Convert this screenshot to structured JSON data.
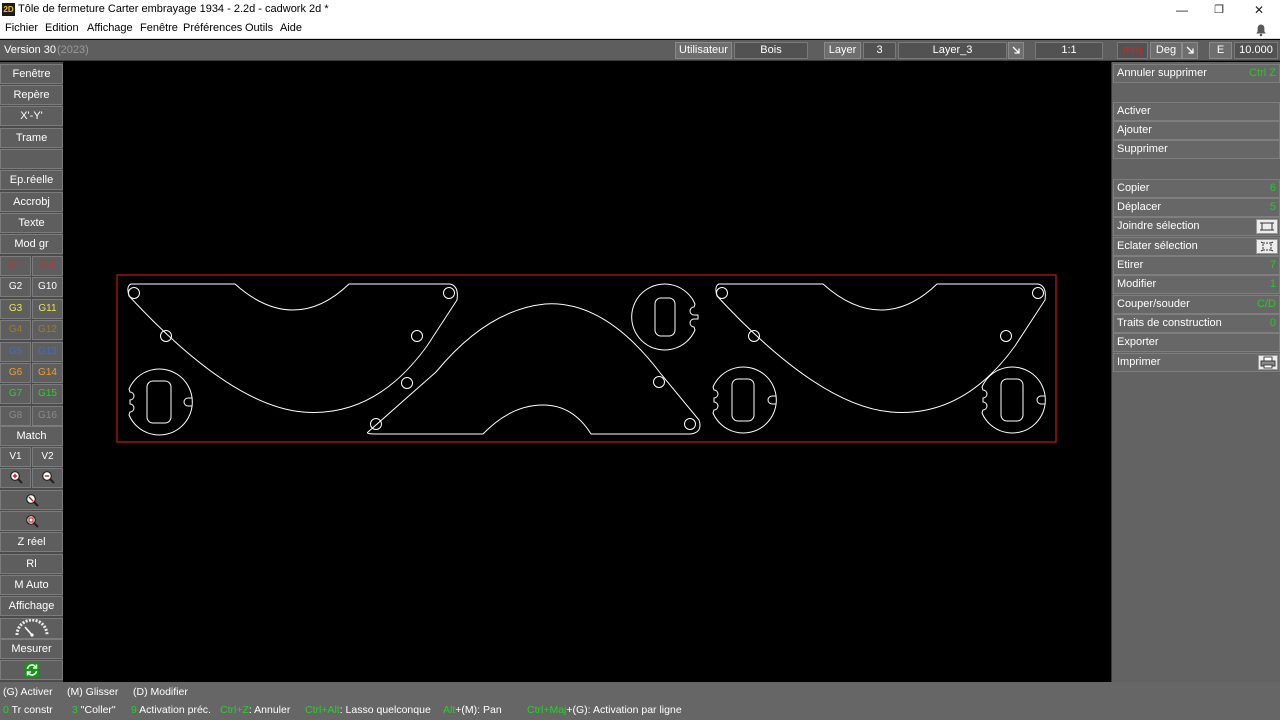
{
  "window": {
    "logo_text": "2D",
    "title": "Tôle de fermeture Carter embrayage 1934 - 2.2d - cadwork 2d  *",
    "minimize_glyph": "—",
    "maximize_glyph": "❐",
    "close_glyph": "✕"
  },
  "menu": [
    "Fichier",
    "Edition",
    "Affichage",
    "Fenêtre",
    "Préférences",
    "Outils",
    "Aide"
  ],
  "toolbar": {
    "version": "Version 30",
    "year": "(2023)",
    "user_label": "Utilisateur",
    "material": "Bois",
    "layer_label": "Layer",
    "layer_number": "3",
    "layer_name": "Layer_3",
    "scale": "1:1",
    "unit": "mm",
    "angle_unit": "Deg",
    "e_label": "E",
    "e_value": "10.000"
  },
  "left_panel": {
    "buttons": [
      "Fenêtre",
      "Repère",
      "X'-Y'",
      "Trame",
      "",
      "Ep.réelle",
      "Accrobj",
      "Texte",
      "Mod gr"
    ],
    "groups": [
      {
        "left": "G1",
        "right": "G9",
        "color": "#d42a2a"
      },
      {
        "left": "G2",
        "right": "G10",
        "color": "#ffffff"
      },
      {
        "left": "G3",
        "right": "G11",
        "color": "#e8e84a"
      },
      {
        "left": "G4",
        "right": "G12",
        "color": "#9c7d2e"
      },
      {
        "left": "G5",
        "right": "G13",
        "color": "#3a6fd0"
      },
      {
        "left": "G6",
        "right": "G14",
        "color": "#f0a020"
      },
      {
        "left": "G7",
        "right": "G15",
        "color": "#2fcf2f"
      },
      {
        "left": "G8",
        "right": "G16",
        "color": "#8a8a8a"
      }
    ],
    "match": "Match",
    "v1": "V1",
    "v2": "V2",
    "zreel": "Z réel",
    "rl": "Rl",
    "mauto": "M Auto",
    "affichage": "Affichage",
    "mesurer": "Mesurer"
  },
  "right_panel": {
    "undo": {
      "label": "Annuler supprimer",
      "key": "Ctrl Z"
    },
    "activer": "Activer",
    "ajouter": "Ajouter",
    "supprimer": "Supprimer",
    "copier": {
      "label": "Copier",
      "key": "6"
    },
    "deplacer": {
      "label": "Déplacer",
      "key": "5"
    },
    "joindre": "Joindre sélection",
    "eclater": "Eclater sélection",
    "etirer": {
      "label": "Etirer",
      "key": "7"
    },
    "modifier": {
      "label": "Modifier",
      "key": "1"
    },
    "couper": {
      "label": "Couper/souder",
      "key": "C/D"
    },
    "traits": {
      "label": "Traits de construction",
      "key": "0"
    },
    "exporter": "Exporter",
    "imprimer": "Imprimer"
  },
  "status": {
    "line1": {
      "activer": "(G) Activer",
      "glisser": "(M) Glisser",
      "modifier": "(D) Modifier"
    },
    "line2": {
      "k0": "0",
      "t0": " Tr constr",
      "k3": "3",
      "t3": " \"Coller\"",
      "k9": "9",
      "t9": " Activation préc.",
      "kz": "Ctrl+Z",
      "tz": ": Annuler",
      "kca": "Ctrl+Alt",
      "tca": ": Lasso quelconque",
      "kam": "Alt",
      "tam": "+(M): Pan",
      "kcm": "Ctrl+Maj",
      "tcm": "+(G): Activation par ligne"
    }
  },
  "colors": {
    "frame": "#c4161c",
    "stroke": "#ffffff",
    "key": "#27d127"
  }
}
